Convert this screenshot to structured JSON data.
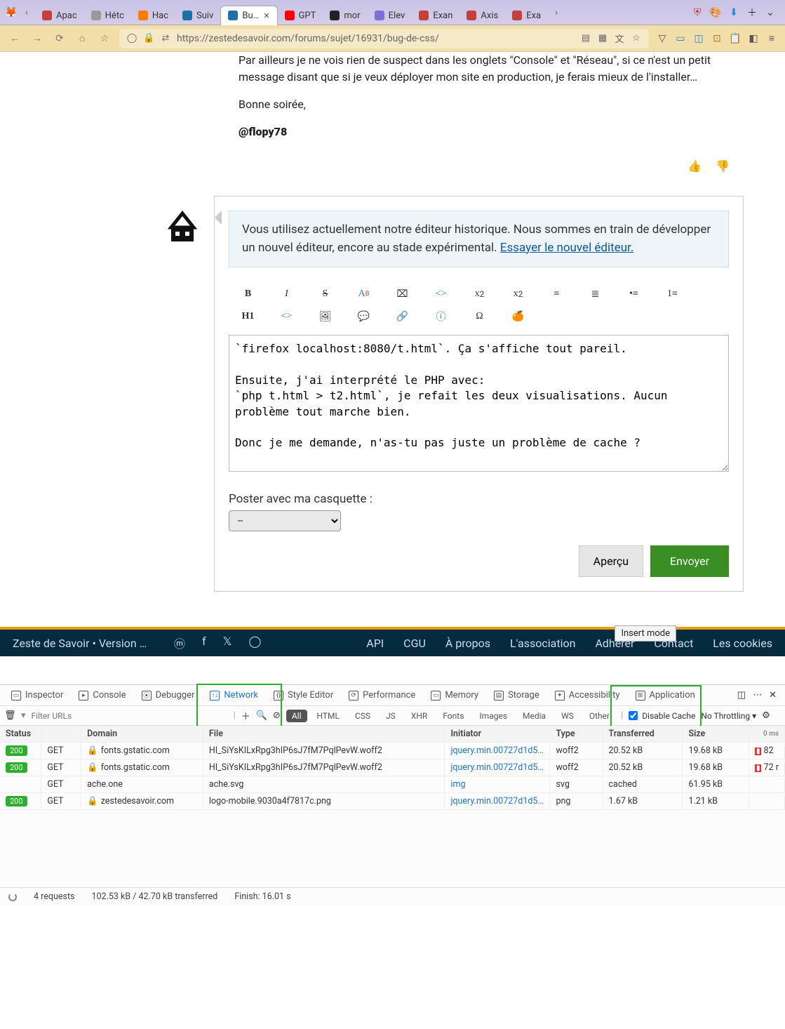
{
  "browser": {
    "tabs": [
      {
        "label": "Apac",
        "fav": "#c4403c"
      },
      {
        "label": "Hétc",
        "fav": "#999"
      },
      {
        "label": "Hac",
        "fav": "#ff7a00"
      },
      {
        "label": "Suiv",
        "fav": "#1f6fa8"
      },
      {
        "label": "Bu…",
        "fav": "#1f6fa8",
        "active": true
      },
      {
        "label": "GPT",
        "fav": "#ff0000"
      },
      {
        "label": "mor",
        "fav": "#222"
      },
      {
        "label": "Elev",
        "fav": "#7e6fd9"
      },
      {
        "label": "Exan",
        "fav": "#c4403c"
      },
      {
        "label": "Axis",
        "fav": "#c4403c"
      },
      {
        "label": "Exa",
        "fav": "#c4403c"
      }
    ],
    "url": "https://zestedesavoir.com/forums/sujet/16931/bug-de-css/"
  },
  "post": {
    "line1": "Par ailleurs je ne vois rien de suspect dans les onglets \"Console\" et \"Réseau\", si ce n'est un petit message disant que si je veux déployer mon site en production, je ferais mieux de l'installer…",
    "line2": "Bonne soirée,",
    "mention": "@flopy78"
  },
  "editor": {
    "bannerText": "Vous utilisez actuellement notre éditeur historique. Nous sommes en train de développer un nouvel éditeur, encore au stade expérimental. ",
    "bannerLink": "Essayer le nouvel éditeur.",
    "text": "`firefox localhost:8080/t.html`. Ça s'affiche tout pareil.\n\nEnsuite, j'ai interprété le PHP avec:\n`php t.html > t2.html`, je refait les deux visualisations. Aucun problème tout marche bien.\n\nDonc je me demande, n'as-tu pas juste un problème de cache ?",
    "casquetteLabel": "Poster avec ma casquette :",
    "casquetteValue": "--",
    "previewBtn": "Aperçu",
    "sendBtn": "Envoyer"
  },
  "footer": {
    "left": "Zeste de Savoir • Version …",
    "links": [
      "API",
      "CGU",
      "À propos",
      "L'association",
      "Adhérer",
      "Contact",
      "Les cookies"
    ]
  },
  "modeTip": "Insert mode",
  "devtools": {
    "tabs": [
      "Inspector",
      "Console",
      "Debugger",
      "Network",
      "Style Editor",
      "Performance",
      "Memory",
      "Storage",
      "Accessibility",
      "Application"
    ],
    "activeTab": "Network",
    "filterPlaceholder": "Filter URLs",
    "chips": [
      "All",
      "HTML",
      "CSS",
      "JS",
      "XHR",
      "Fonts",
      "Images",
      "Media",
      "WS",
      "Other"
    ],
    "chipSel": "All",
    "disableCache": "Disable Cache",
    "throttling": "No Throttling",
    "headers": [
      "Status",
      "",
      "Domain",
      "File",
      "Initiator",
      "Type",
      "Transferred",
      "Size",
      ""
    ],
    "timelineEnd": "0 ms",
    "rows": [
      {
        "status": "200",
        "method": "GET",
        "domain": "fonts.gstatic.com",
        "lock": true,
        "file": "HI_SiYsKILxRpg3hIP6sJ7fM7PqlPevW.woff2",
        "initiator": "jquery.min.00727d1d5d9…",
        "type": "woff2",
        "transferred": "20.52 kB",
        "size": "19.68 kB",
        "wf": "82",
        "wfc": "#d33"
      },
      {
        "status": "200",
        "method": "GET",
        "domain": "fonts.gstatic.com",
        "lock": true,
        "file": "HI_SiYsKILxRpg3hIP6sJ7fM7PqlPevW.woff2",
        "initiator": "jquery.min.00727d1d5d9…",
        "type": "woff2",
        "transferred": "20.52 kB",
        "size": "19.68 kB",
        "wf": "72 r",
        "wfc": "#d33"
      },
      {
        "status": "",
        "method": "GET",
        "domain": "ache.one",
        "lock": false,
        "file": "ache.svg",
        "initiator": "img",
        "type": "svg",
        "transferred": "cached",
        "size": "61.95 kB",
        "wf": "",
        "wfc": ""
      },
      {
        "status": "200",
        "method": "GET",
        "domain": "zestedesavoir.com",
        "lock": true,
        "file": "logo-mobile.9030a4f7817c.png",
        "initiator": "jquery.min.00727d1d5d9…",
        "type": "png",
        "transferred": "1.67 kB",
        "size": "1.21 kB",
        "wf": "",
        "wfc": ""
      }
    ],
    "status": {
      "requests": "4 requests",
      "transferred": "102.53 kB / 42.70 kB transferred",
      "finish": "Finish: 16.01 s"
    }
  }
}
